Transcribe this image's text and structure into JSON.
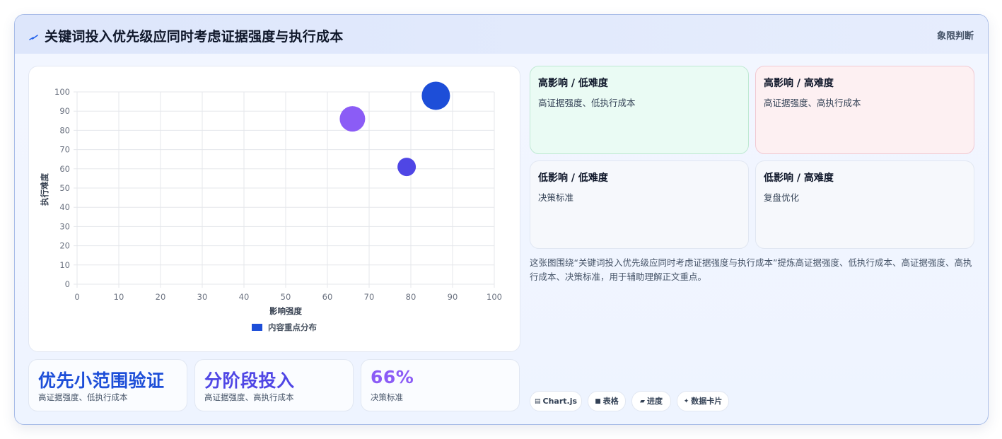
{
  "header": {
    "title": "关键词投入优先级应同时考虑证据强度与执行成本",
    "tag": "象限判断",
    "icon": "lightning-icon"
  },
  "chart_data": {
    "type": "scatter",
    "xlabel": "影响强度",
    "ylabel": "执行难度",
    "xlim": [
      0,
      100
    ],
    "ylim": [
      0,
      100
    ],
    "xticks": [
      0,
      10,
      20,
      30,
      40,
      50,
      60,
      70,
      80,
      90,
      100
    ],
    "yticks": [
      0,
      10,
      20,
      30,
      40,
      50,
      60,
      70,
      80,
      90,
      100
    ],
    "grid": true,
    "legend_position": "bottom",
    "legend_label": "内容重点分布",
    "legend_color": "#1d4ed8",
    "points": [
      {
        "x": 86,
        "y": 98,
        "r": 20,
        "color": "#1d4ed8"
      },
      {
        "x": 66,
        "y": 86,
        "r": 18,
        "color": "#8b5cf6"
      },
      {
        "x": 79,
        "y": 61,
        "r": 13,
        "color": "#4f46e5"
      }
    ]
  },
  "quadrants": [
    {
      "title": "高影响 / 低难度",
      "desc": "高证据强度、低执行成本",
      "tone": "green"
    },
    {
      "title": "高影响 / 高难度",
      "desc": "高证据强度、高执行成本",
      "tone": "pink"
    },
    {
      "title": "低影响 / 低难度",
      "desc": "决策标准",
      "tone": "neutral"
    },
    {
      "title": "低影响 / 高难度",
      "desc": "复盘优化",
      "tone": "neutral"
    }
  ],
  "summary": "这张图围绕“关键词投入优先级应同时考虑证据强度与执行成本”提炼高证据强度、低执行成本、高证据强度、高执行成本、决策标准，用于辅助理解正文重点。",
  "stats": [
    {
      "value": "优先小范围验证",
      "label": "高证据强度、低执行成本",
      "color": "#1d4ed8"
    },
    {
      "value": "分阶段投入",
      "label": "高证据强度、高执行成本",
      "color": "#4f46e5"
    },
    {
      "value": "66%",
      "label": "决策标准",
      "color": "#8b5cf6"
    }
  ],
  "chips": [
    {
      "icon": "▤",
      "label": "Chart.js"
    },
    {
      "icon": "■",
      "label": "表格"
    },
    {
      "icon": "▰",
      "label": "进度"
    },
    {
      "icon": "✦",
      "label": "数据卡片"
    }
  ]
}
